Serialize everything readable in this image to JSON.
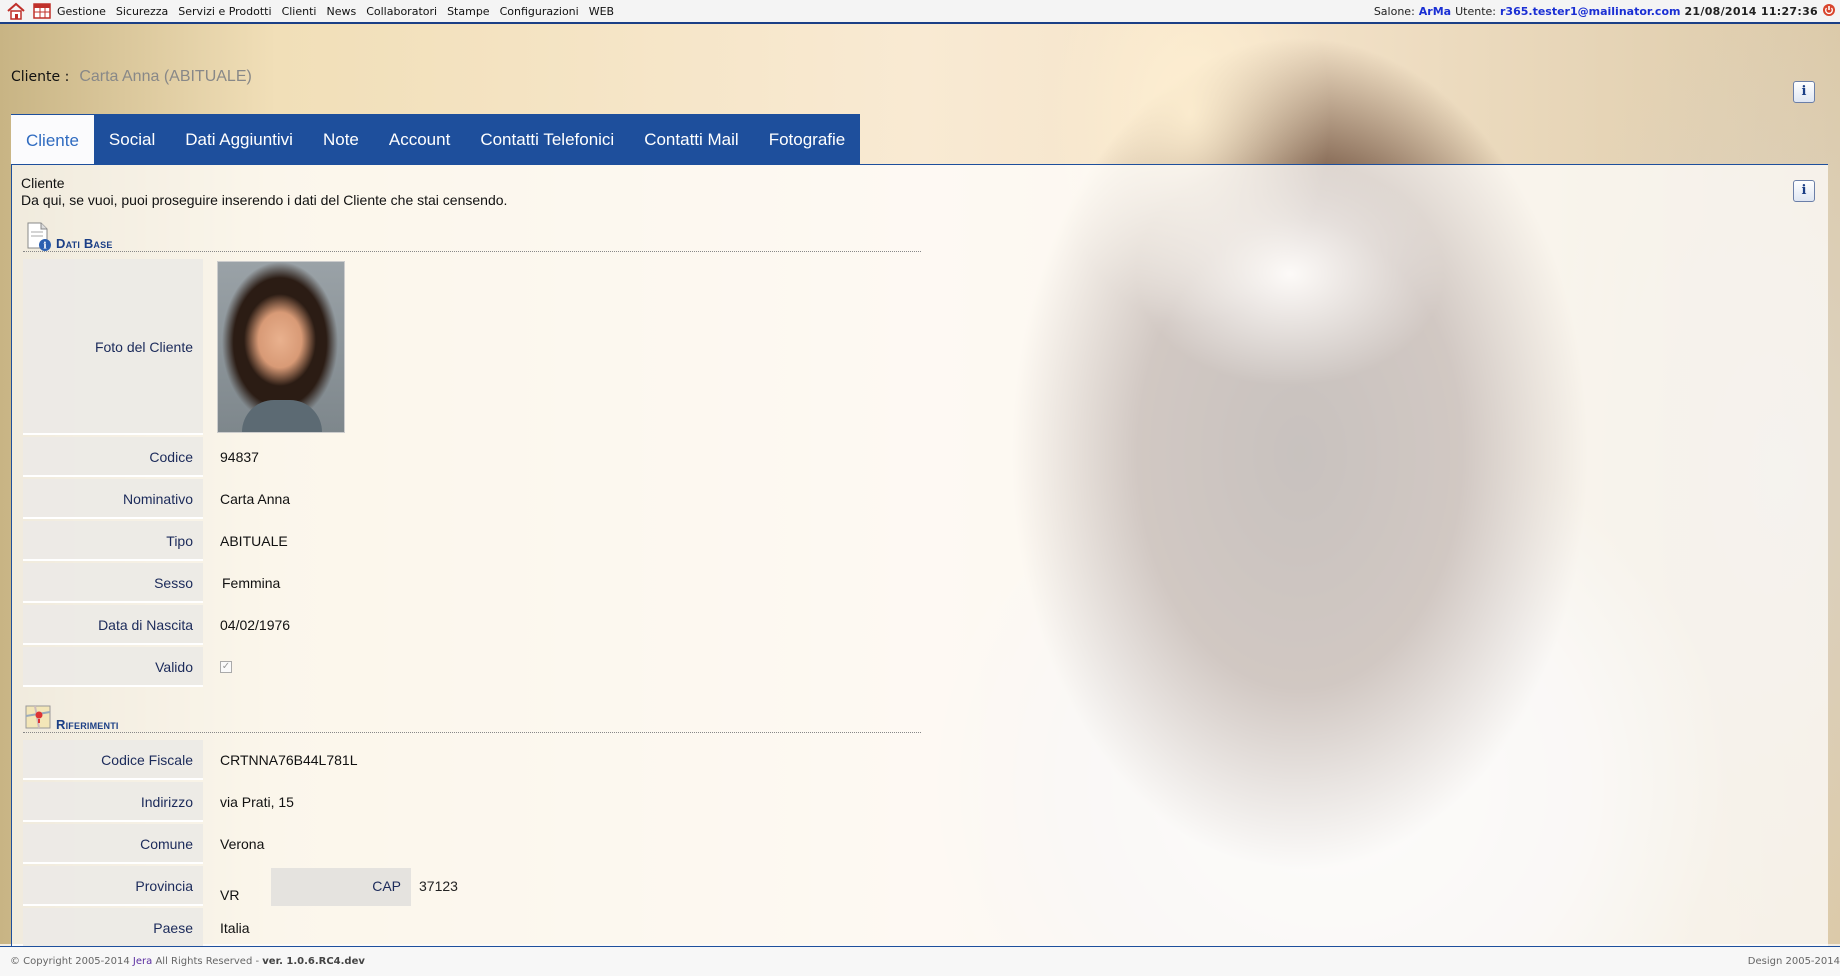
{
  "topbar": {
    "menu": [
      "Gestione",
      "Sicurezza",
      "Servizi e Prodotti",
      "Clienti",
      "News",
      "Collaboratori",
      "Stampe",
      "Configurazioni",
      "WEB"
    ],
    "salone_label": "Salone:",
    "salone_value": "ArMa",
    "utente_label": "Utente:",
    "utente_value": "r365.tester1@mailinator.com",
    "datetime": "21/08/2014  11:27:36",
    "icons": [
      "home-icon",
      "calendar-icon",
      "logout-icon"
    ]
  },
  "header": {
    "label": "Cliente :",
    "value": "Carta Anna (ABITUALE)"
  },
  "info_button": "i",
  "tabs": [
    "Cliente",
    "Social",
    "Dati Aggiuntivi",
    "Note",
    "Account",
    "Contatti Telefonici",
    "Contatti Mail",
    "Fotografie"
  ],
  "panel": {
    "title": "Cliente",
    "description": "Da qui, se vuoi, puoi proseguire inserendo i dati del Cliente che stai censendo."
  },
  "section_base": {
    "title": "Dati Base",
    "photo_label": "Foto del Cliente",
    "fields": [
      {
        "label": "Codice",
        "value": "94837"
      },
      {
        "label": "Nominativo",
        "value": "Carta Anna"
      },
      {
        "label": "Tipo",
        "value": "ABITUALE"
      },
      {
        "label": "Sesso",
        "value": "Femmina"
      },
      {
        "label": "Data di Nascita",
        "value": "04/02/1976"
      },
      {
        "label": "Valido",
        "value": ""
      }
    ],
    "valido_checked": true
  },
  "section_rif": {
    "title": "Riferimenti",
    "fields": [
      {
        "label": "Codice Fiscale",
        "value": "CRTNNA76B44L781L"
      },
      {
        "label": "Indirizzo",
        "value": "via Prati, 15"
      },
      {
        "label": "Comune",
        "value": "Verona"
      },
      {
        "label": "Provincia",
        "value": "VR"
      },
      {
        "label": "Paese",
        "value": "Italia"
      }
    ],
    "cap_label": "CAP",
    "cap_value": "37123"
  },
  "footer": {
    "copyright": "© Copyright 2005-2014",
    "company": "Jera",
    "rights": "All Rights Reserved -",
    "version": "ver. 1.0.6.RC4.dev",
    "design": "Design 2005-2014"
  }
}
